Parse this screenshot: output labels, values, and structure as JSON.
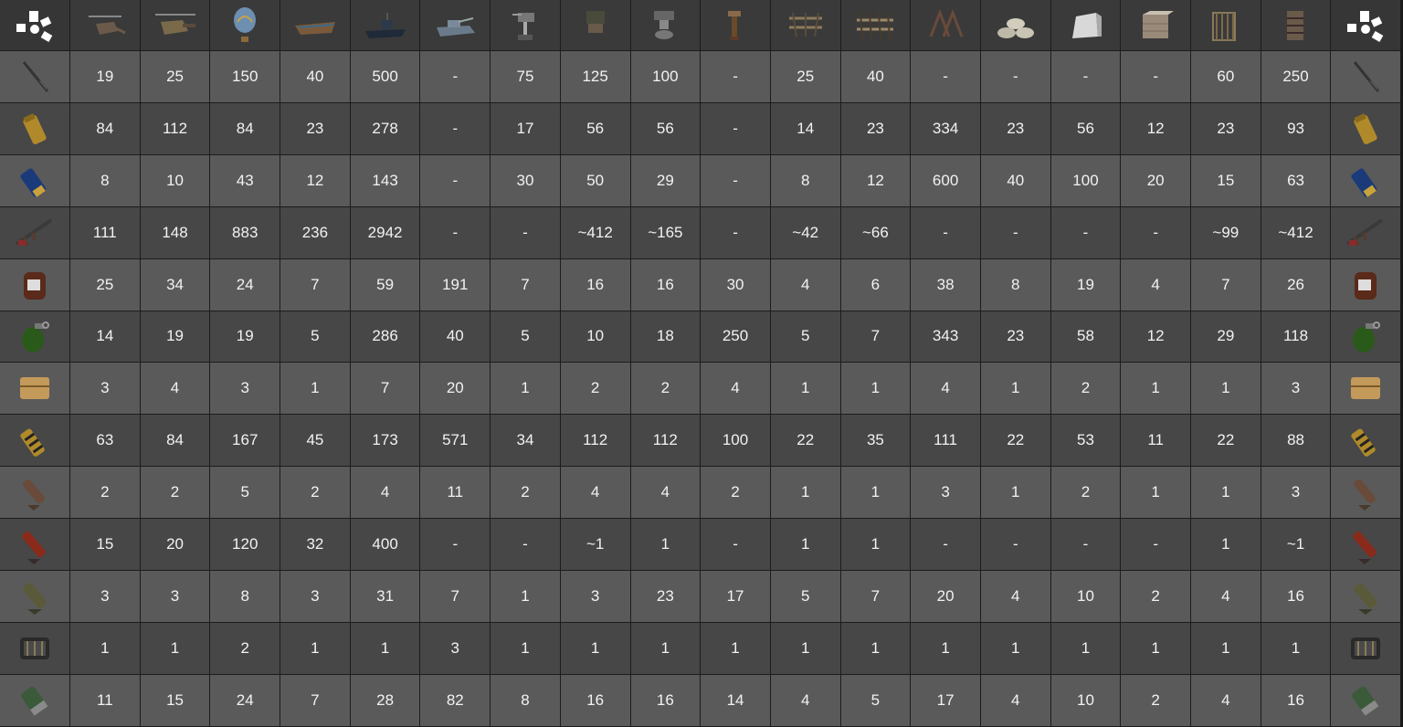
{
  "header_icons": [
    "rust-logo-icon",
    "minicopter-icon",
    "scrap-helicopter-icon",
    "hot-air-balloon-icon",
    "rowboat-icon",
    "rhib-boat-icon",
    "bradley-apc-icon",
    "auto-turret-icon",
    "sam-site-icon",
    "flame-turret-icon",
    "shotgun-trap-icon",
    "wooden-barricade-icon",
    "spiked-barricade-icon",
    "wire-barricade-icon",
    "sandbag-barricade-icon",
    "concrete-barricade-icon",
    "stone-barricade-icon",
    "wooden-cover-icon",
    "metal-cover-icon",
    "rust-logo-icon"
  ],
  "row_icons": [
    "spear-icon",
    "incendiary-ammo-icon",
    "shotgun-shell-icon",
    "assault-rifle-icon",
    "beancan-grenade-icon",
    "f1-grenade-icon",
    "satchel-charge-icon",
    "explosive-ammo-icon",
    "hv-rocket-icon",
    "incendiary-rocket-icon",
    "rocket-icon",
    "c4-icon",
    "40mm-he-grenade-icon"
  ],
  "rows": [
    [
      "19",
      "25",
      "150",
      "40",
      "500",
      "-",
      "75",
      "125",
      "100",
      "-",
      "25",
      "40",
      "-",
      "-",
      "-",
      "-",
      "60",
      "250"
    ],
    [
      "84",
      "112",
      "84",
      "23",
      "278",
      "-",
      "17",
      "56",
      "56",
      "-",
      "14",
      "23",
      "334",
      "23",
      "56",
      "12",
      "23",
      "93"
    ],
    [
      "8",
      "10",
      "43",
      "12",
      "143",
      "-",
      "30",
      "50",
      "29",
      "-",
      "8",
      "12",
      "600",
      "40",
      "100",
      "20",
      "15",
      "63"
    ],
    [
      "111",
      "148",
      "883",
      "236",
      "2942",
      "-",
      "-",
      "~412",
      "~165",
      "-",
      "~42",
      "~66",
      "-",
      "-",
      "-",
      "-",
      "~99",
      "~412"
    ],
    [
      "25",
      "34",
      "24",
      "7",
      "59",
      "191",
      "7",
      "16",
      "16",
      "30",
      "4",
      "6",
      "38",
      "8",
      "19",
      "4",
      "7",
      "26"
    ],
    [
      "14",
      "19",
      "19",
      "5",
      "286",
      "40",
      "5",
      "10",
      "18",
      "250",
      "5",
      "7",
      "343",
      "23",
      "58",
      "12",
      "29",
      "118"
    ],
    [
      "3",
      "4",
      "3",
      "1",
      "7",
      "20",
      "1",
      "2",
      "2",
      "4",
      "1",
      "1",
      "4",
      "1",
      "2",
      "1",
      "1",
      "3"
    ],
    [
      "63",
      "84",
      "167",
      "45",
      "173",
      "571",
      "34",
      "112",
      "112",
      "100",
      "22",
      "35",
      "111",
      "22",
      "53",
      "11",
      "22",
      "88"
    ],
    [
      "2",
      "2",
      "5",
      "2",
      "4",
      "11",
      "2",
      "4",
      "4",
      "2",
      "1",
      "1",
      "3",
      "1",
      "2",
      "1",
      "1",
      "3"
    ],
    [
      "15",
      "20",
      "120",
      "32",
      "400",
      "-",
      "-",
      "~1",
      "1",
      "-",
      "1",
      "1",
      "-",
      "-",
      "-",
      "-",
      "1",
      "~1"
    ],
    [
      "3",
      "3",
      "8",
      "3",
      "31",
      "7",
      "1",
      "3",
      "23",
      "17",
      "5",
      "7",
      "20",
      "4",
      "10",
      "2",
      "4",
      "16"
    ],
    [
      "1",
      "1",
      "2",
      "1",
      "1",
      "3",
      "1",
      "1",
      "1",
      "1",
      "1",
      "1",
      "1",
      "1",
      "1",
      "1",
      "1",
      "1"
    ],
    [
      "11",
      "15",
      "24",
      "7",
      "28",
      "82",
      "8",
      "16",
      "16",
      "14",
      "4",
      "5",
      "17",
      "4",
      "10",
      "2",
      "4",
      "16"
    ]
  ]
}
